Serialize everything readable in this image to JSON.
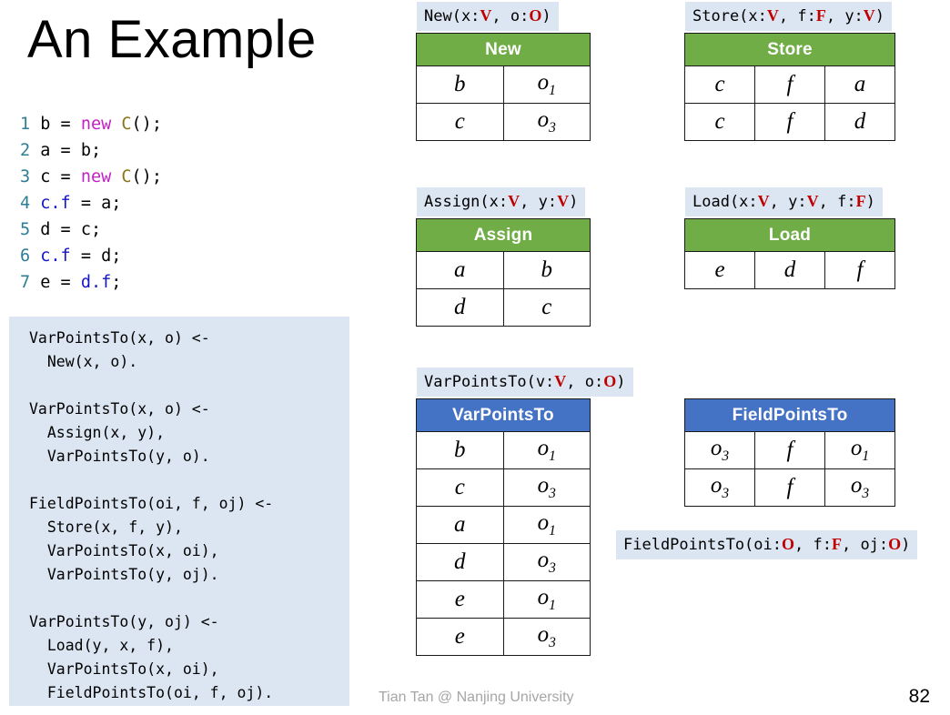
{
  "slide": {
    "title": "An Example",
    "footer_credit": "Tian Tan @ Nanjing University",
    "number": "82"
  },
  "colors": {
    "fact_header_green": "#70AD47",
    "derived_header_blue": "#4472C4",
    "chip_background": "#DCE6F2",
    "type_red": "#C00000",
    "line_number_teal": "#2E7D95",
    "keyword_magenta": "#C421C4",
    "class_olive": "#8A7318",
    "field_blue": "#1515C8"
  },
  "code_listing": {
    "lines": [
      {
        "num": "1",
        "tokens": [
          {
            "t": "plain",
            "s": " b = "
          },
          {
            "t": "kw",
            "s": "new"
          },
          {
            "t": "plain",
            "s": " "
          },
          {
            "t": "cls",
            "s": "C"
          },
          {
            "t": "plain",
            "s": "();"
          }
        ]
      },
      {
        "num": "2",
        "tokens": [
          {
            "t": "plain",
            "s": " a = b;"
          }
        ]
      },
      {
        "num": "3",
        "tokens": [
          {
            "t": "plain",
            "s": " c = "
          },
          {
            "t": "kw",
            "s": "new"
          },
          {
            "t": "plain",
            "s": " "
          },
          {
            "t": "cls",
            "s": "C"
          },
          {
            "t": "plain",
            "s": "();"
          }
        ]
      },
      {
        "num": "4",
        "tokens": [
          {
            "t": "plain",
            "s": " "
          },
          {
            "t": "fld",
            "s": "c.f"
          },
          {
            "t": "plain",
            "s": " = a;"
          }
        ]
      },
      {
        "num": "5",
        "tokens": [
          {
            "t": "plain",
            "s": " d = c;"
          }
        ]
      },
      {
        "num": "6",
        "tokens": [
          {
            "t": "plain",
            "s": " "
          },
          {
            "t": "fld",
            "s": "c.f"
          },
          {
            "t": "plain",
            "s": " = d;"
          }
        ]
      },
      {
        "num": "7",
        "tokens": [
          {
            "t": "plain",
            "s": " e = "
          },
          {
            "t": "fld",
            "s": "d.f"
          },
          {
            "t": "plain",
            "s": ";"
          }
        ]
      }
    ]
  },
  "rules_panel": {
    "text": "VarPointsTo(x, o) <-\n  New(x, o).\n\nVarPointsTo(x, o) <-\n  Assign(x, y),\n  VarPointsTo(y, o).\n\nFieldPointsTo(oi, f, oj) <-\n  Store(x, f, y),\n  VarPointsTo(x, oi),\n  VarPointsTo(y, oj).\n\nVarPointsTo(y, oj) <-\n  Load(y, x, f),\n  VarPointsTo(x, oi),\n  FieldPointsTo(oi, f, oj)."
  },
  "signatures": {
    "new": [
      {
        "t": "p",
        "s": "New(x:"
      },
      {
        "t": "t",
        "s": "V"
      },
      {
        "t": "p",
        "s": ", o:"
      },
      {
        "t": "t",
        "s": "O"
      },
      {
        "t": "p",
        "s": ")"
      }
    ],
    "store": [
      {
        "t": "p",
        "s": "Store(x:"
      },
      {
        "t": "t",
        "s": "V"
      },
      {
        "t": "p",
        "s": ", f:"
      },
      {
        "t": "t",
        "s": "F"
      },
      {
        "t": "p",
        "s": ", y:"
      },
      {
        "t": "t",
        "s": "V"
      },
      {
        "t": "p",
        "s": ")"
      }
    ],
    "assign": [
      {
        "t": "p",
        "s": "Assign(x:"
      },
      {
        "t": "t",
        "s": "V"
      },
      {
        "t": "p",
        "s": ", y:"
      },
      {
        "t": "t",
        "s": "V"
      },
      {
        "t": "p",
        "s": ")"
      }
    ],
    "load": [
      {
        "t": "p",
        "s": "Load(x:"
      },
      {
        "t": "t",
        "s": "V"
      },
      {
        "t": "p",
        "s": ", y:"
      },
      {
        "t": "t",
        "s": "V"
      },
      {
        "t": "p",
        "s": ", f:"
      },
      {
        "t": "t",
        "s": "F"
      },
      {
        "t": "p",
        "s": ")"
      }
    ],
    "varpointsto": [
      {
        "t": "p",
        "s": "VarPointsTo(v:"
      },
      {
        "t": "t",
        "s": "V"
      },
      {
        "t": "p",
        "s": ", o:"
      },
      {
        "t": "t",
        "s": "O"
      },
      {
        "t": "p",
        "s": ")"
      }
    ],
    "fieldpointsto": [
      {
        "t": "p",
        "s": "FieldPointsTo(oi:"
      },
      {
        "t": "t",
        "s": "O"
      },
      {
        "t": "p",
        "s": ", f:"
      },
      {
        "t": "t",
        "s": "F"
      },
      {
        "t": "p",
        "s": ", oj:"
      },
      {
        "t": "t",
        "s": "O"
      },
      {
        "t": "p",
        "s": ")"
      }
    ]
  },
  "tables": {
    "new": {
      "header": "New",
      "header_style": "green",
      "columns": 2,
      "rows": [
        [
          "b",
          "o₁"
        ],
        [
          "c",
          "o₃"
        ]
      ]
    },
    "store": {
      "header": "Store",
      "header_style": "green",
      "columns": 3,
      "rows": [
        [
          "c",
          "f",
          "a"
        ],
        [
          "c",
          "f",
          "d"
        ]
      ]
    },
    "assign": {
      "header": "Assign",
      "header_style": "green",
      "columns": 2,
      "rows": [
        [
          "a",
          "b"
        ],
        [
          "d",
          "c"
        ]
      ]
    },
    "load": {
      "header": "Load",
      "header_style": "green",
      "columns": 3,
      "rows": [
        [
          "e",
          "d",
          "f"
        ]
      ]
    },
    "varpointsto": {
      "header": "VarPointsTo",
      "header_style": "blue",
      "columns": 2,
      "rows": [
        [
          "b",
          "o₁"
        ],
        [
          "c",
          "o₃"
        ],
        [
          "a",
          "o₁"
        ],
        [
          "d",
          "o₃"
        ],
        [
          "e",
          "o₁"
        ],
        [
          "e",
          "o₃"
        ]
      ]
    },
    "fieldpointsto": {
      "header": "FieldPointsTo",
      "header_style": "blue",
      "columns": 3,
      "rows": [
        [
          "o₃",
          "f",
          "o₁"
        ],
        [
          "o₃",
          "f",
          "o₃"
        ]
      ]
    }
  }
}
